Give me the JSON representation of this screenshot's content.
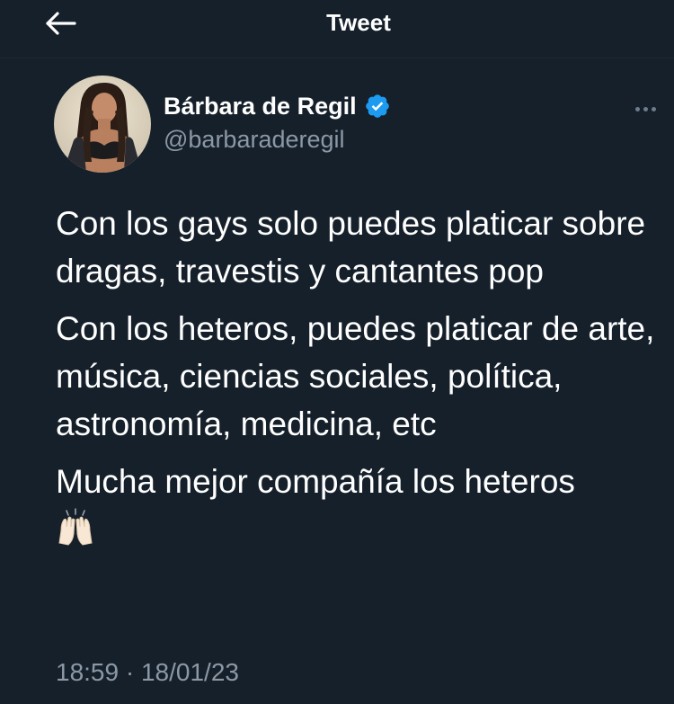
{
  "header": {
    "title": "Tweet",
    "back_icon": "arrow-left-icon"
  },
  "author": {
    "display_name": "Bárbara de Regil",
    "handle": "@barbaraderegil",
    "verified": true,
    "verified_icon": "verified-badge-icon",
    "verified_color": "#1d9bf0"
  },
  "more_icon": "more-horizontal-icon",
  "tweet": {
    "paragraphs": [
      "Con los gays solo puedes platicar sobre dragas, travestis y cantantes pop",
      "Con los heteros, puedes platicar de arte, música, ciencias sociales, política, astronomía, medicina, etc",
      "Mucha mejor compañía los heteros"
    ],
    "emoji": "raising-hands-emoji"
  },
  "meta": {
    "time": "18:59",
    "separator": "·",
    "date": "18/01/23"
  },
  "colors": {
    "background": "#15202b",
    "text_primary": "#ffffff",
    "text_secondary": "#8b98a5",
    "accent": "#1d9bf0"
  }
}
